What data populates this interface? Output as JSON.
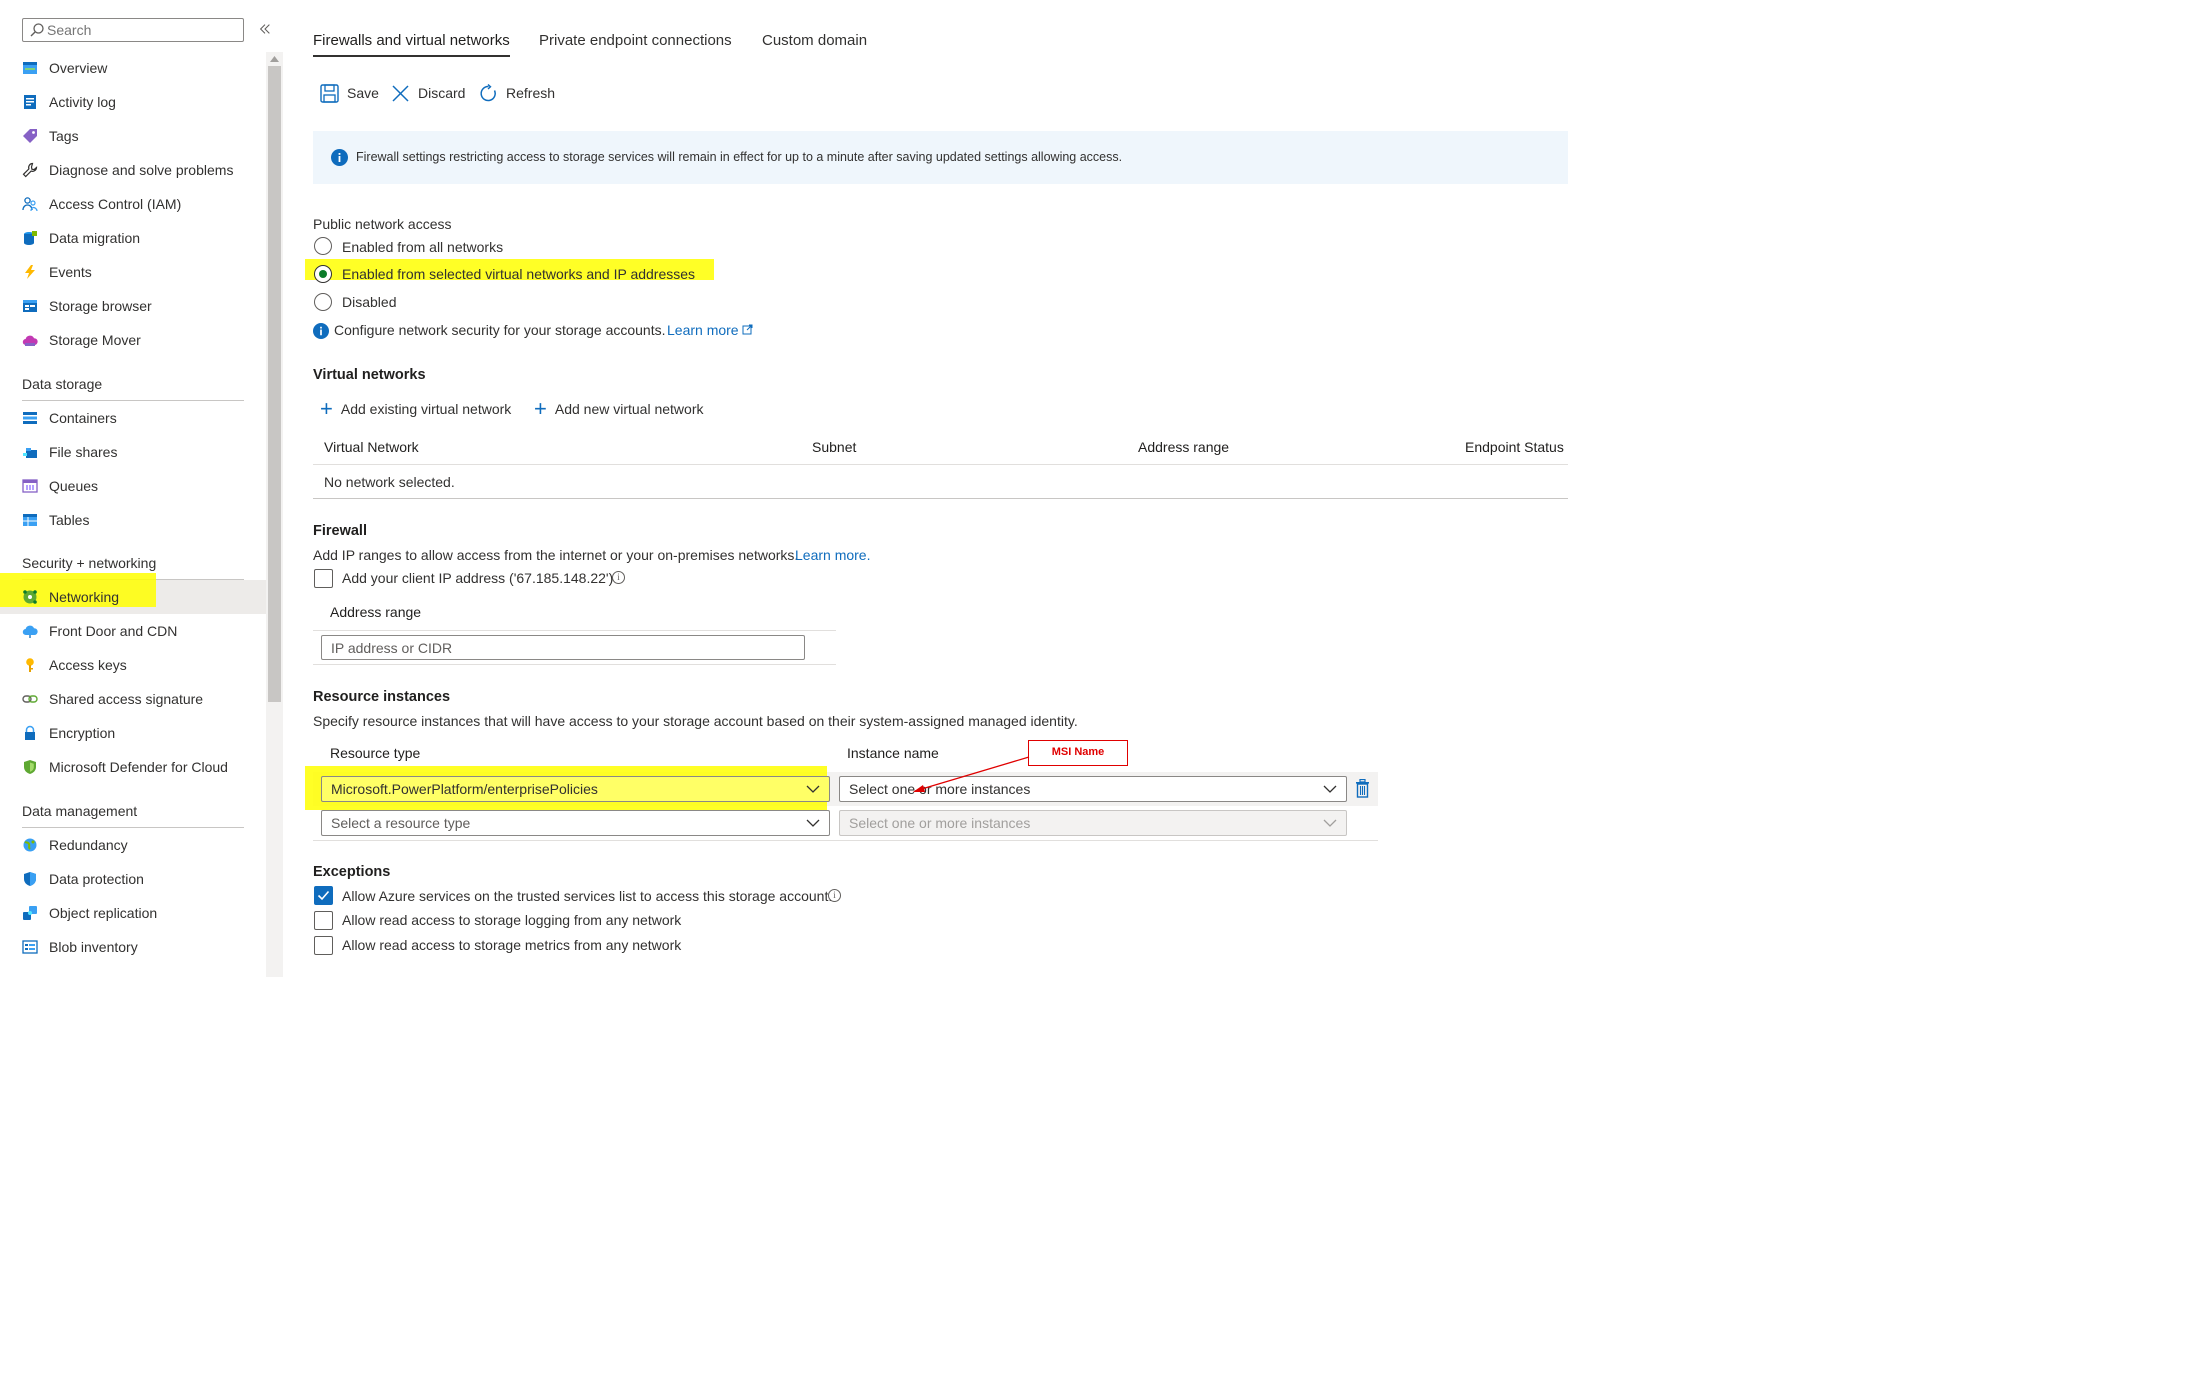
{
  "colors": {
    "accent": "#0f6cbd",
    "highlight": "#ffff00",
    "annotation": "#e00000",
    "selected_radio": "#0b7c2a",
    "info_bar_bg": "#eff6fc"
  },
  "sidebar": {
    "search_placeholder": "Search",
    "collapse_icon": "chevron-double-left-icon",
    "top_items": [
      {
        "label": "Overview",
        "icon": "overview-icon"
      },
      {
        "label": "Activity log",
        "icon": "activity-log-icon"
      },
      {
        "label": "Tags",
        "icon": "tag-icon"
      },
      {
        "label": "Diagnose and solve problems",
        "icon": "wrench-icon"
      },
      {
        "label": "Access Control (IAM)",
        "icon": "people-icon"
      },
      {
        "label": "Data migration",
        "icon": "data-migration-icon"
      },
      {
        "label": "Events",
        "icon": "lightning-icon"
      },
      {
        "label": "Storage browser",
        "icon": "storage-browser-icon"
      },
      {
        "label": "Storage Mover",
        "icon": "cloud-mover-icon"
      }
    ],
    "sections": [
      {
        "title": "Data storage",
        "items": [
          {
            "label": "Containers",
            "icon": "containers-icon"
          },
          {
            "label": "File shares",
            "icon": "file-shares-icon"
          },
          {
            "label": "Queues",
            "icon": "queues-icon"
          },
          {
            "label": "Tables",
            "icon": "tables-icon"
          }
        ]
      },
      {
        "title": "Security + networking",
        "items": [
          {
            "label": "Networking",
            "icon": "networking-icon",
            "selected": true
          },
          {
            "label": "Front Door and CDN",
            "icon": "cloud-cdn-icon"
          },
          {
            "label": "Access keys",
            "icon": "key-icon"
          },
          {
            "label": "Shared access signature",
            "icon": "link-chain-icon"
          },
          {
            "label": "Encryption",
            "icon": "lock-icon"
          },
          {
            "label": "Microsoft Defender for Cloud",
            "icon": "shield-icon"
          }
        ]
      },
      {
        "title": "Data management",
        "items": [
          {
            "label": "Redundancy",
            "icon": "globe-icon"
          },
          {
            "label": "Data protection",
            "icon": "shield-check-icon"
          },
          {
            "label": "Object replication",
            "icon": "replication-icon"
          },
          {
            "label": "Blob inventory",
            "icon": "inventory-icon"
          }
        ]
      }
    ]
  },
  "tabs": [
    {
      "label": "Firewalls and virtual networks",
      "active": true
    },
    {
      "label": "Private endpoint connections"
    },
    {
      "label": "Custom domain"
    }
  ],
  "toolbar": {
    "save": "Save",
    "discard": "Discard",
    "refresh": "Refresh"
  },
  "info_bar": {
    "text": "Firewall settings restricting access to storage services will remain in effect for up to a minute after saving updated settings allowing access."
  },
  "public_network_access": {
    "label": "Public network access",
    "options": [
      {
        "label": "Enabled from all networks",
        "selected": false
      },
      {
        "label": "Enabled from selected virtual networks and IP addresses",
        "selected": true
      },
      {
        "label": "Disabled",
        "selected": false
      }
    ],
    "note": "Configure network security for your storage accounts.",
    "learn_more": "Learn more"
  },
  "virtual_networks": {
    "title": "Virtual networks",
    "add_existing": "Add existing virtual network",
    "add_new": "Add new virtual network",
    "columns": [
      "Virtual Network",
      "Subnet",
      "Address range",
      "Endpoint Status"
    ],
    "empty_text": "No network selected."
  },
  "firewall": {
    "title": "Firewall",
    "description": "Add IP ranges to allow access from the internet or your on-premises networks.",
    "learn_more": "Learn more.",
    "client_ip_label": "Add your client IP address ('67.185.148.22')",
    "client_ip_checked": false,
    "address_range_header": "Address range",
    "address_placeholder": "IP address or CIDR"
  },
  "resource_instances": {
    "title": "Resource instances",
    "description": "Specify resource instances that will have access to your storage account based on their system-assigned managed identity.",
    "col_resource_type": "Resource type",
    "col_instance_name": "Instance name",
    "rows": [
      {
        "resource_type": "Microsoft.PowerPlatform/enterprisePolicies",
        "instance": "Select one or more instances"
      },
      {
        "resource_type": "Select a resource type",
        "instance": "Select one or more instances"
      }
    ],
    "annotation": "MSI Name"
  },
  "exceptions": {
    "title": "Exceptions",
    "items": [
      {
        "label": "Allow Azure services on the trusted services list to access this storage account.",
        "checked": true
      },
      {
        "label": "Allow read access to storage logging from any network",
        "checked": false
      },
      {
        "label": "Allow read access to storage metrics from any network",
        "checked": false
      }
    ]
  }
}
